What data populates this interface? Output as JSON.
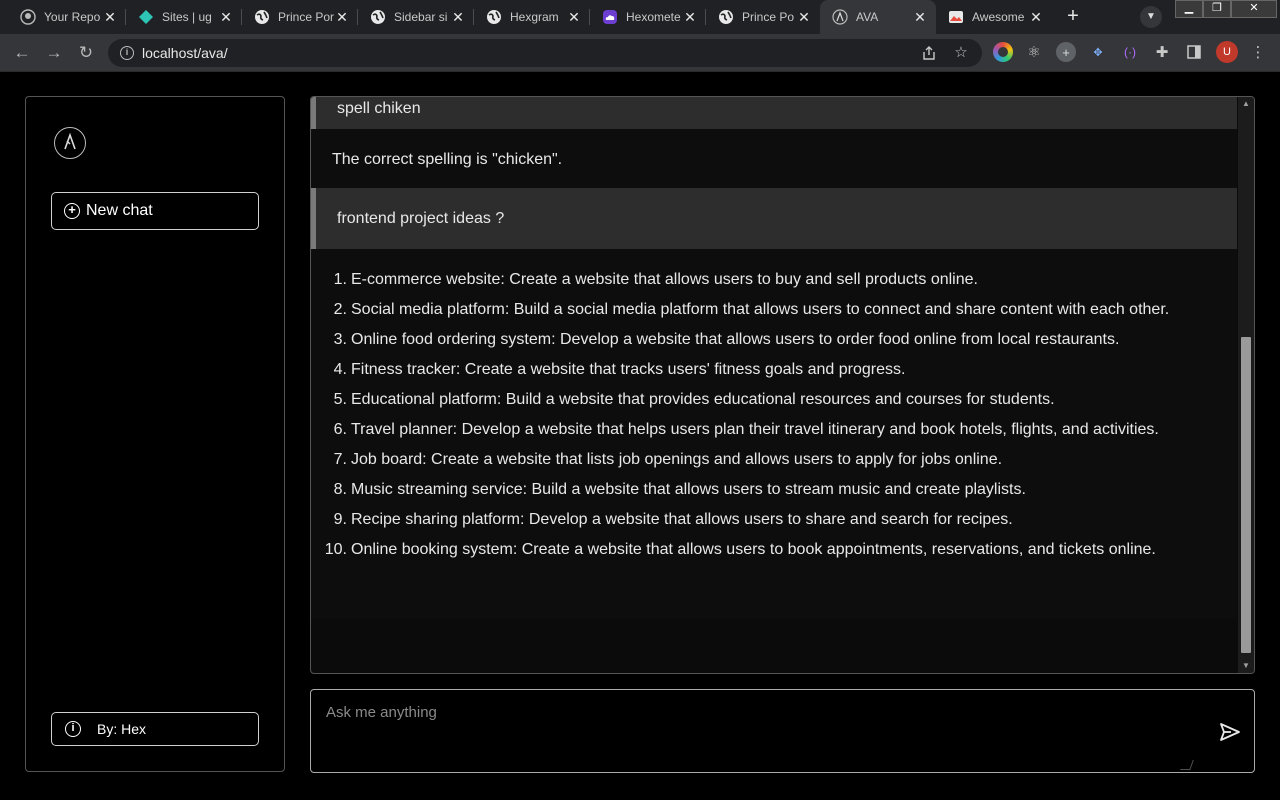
{
  "browser": {
    "tabs": [
      {
        "title": "Your Repo",
        "favicon": "github-icon"
      },
      {
        "title": "Sites | ug",
        "favicon": "diamond-icon"
      },
      {
        "title": "Prince Por",
        "favicon": "globe-icon"
      },
      {
        "title": "Sidebar si",
        "favicon": "globe-icon"
      },
      {
        "title": "Hexgram",
        "favicon": "globe-icon"
      },
      {
        "title": "Hexomete",
        "favicon": "cloud-icon"
      },
      {
        "title": "Prince Po",
        "favicon": "globe-icon"
      },
      {
        "title": "AVA",
        "favicon": "ava-logo-icon",
        "active": true
      },
      {
        "title": "Awesome",
        "favicon": "image-icon"
      }
    ],
    "url": "localhost/ava/",
    "avatar_letter": "U"
  },
  "sidebar": {
    "new_chat_label": "New chat",
    "credit_label": "By: Hex"
  },
  "chat": {
    "messages": [
      {
        "role": "user",
        "text": "spell chiken"
      },
      {
        "role": "assistant",
        "text": "The correct spelling is \"chicken\"."
      },
      {
        "role": "user",
        "text": "frontend project ideas ?"
      },
      {
        "role": "assistant",
        "list": [
          {
            "n": "1.",
            "text": "E-commerce website: Create a website that allows users to buy and sell products online."
          },
          {
            "n": "2.",
            "text": "Social media platform: Build a social media platform that allows users to connect and share content with each other."
          },
          {
            "n": "3.",
            "text": "Online food ordering system: Develop a website that allows users to order food online from local restaurants."
          },
          {
            "n": "4.",
            "text": "Fitness tracker: Create a website that tracks users' fitness goals and progress."
          },
          {
            "n": "5.",
            "text": "Educational platform: Build a website that provides educational resources and courses for students."
          },
          {
            "n": "6.",
            "text": "Travel planner: Develop a website that helps users plan their travel itinerary and book hotels, flights, and activities."
          },
          {
            "n": "7.",
            "text": "Job board: Create a website that lists job openings and allows users to apply for jobs online."
          },
          {
            "n": "8.",
            "text": "Music streaming service: Build a website that allows users to stream music and create playlists."
          },
          {
            "n": "9.",
            "text": "Recipe sharing platform: Develop a website that allows users to share and search for recipes."
          },
          {
            "n": "10.",
            "text": "Online booking system: Create a website that allows users to book appointments, reservations, and tickets online."
          }
        ]
      }
    ]
  },
  "composer": {
    "placeholder": "Ask me anything"
  },
  "colors": {
    "background": "#000000",
    "user_bubble": "#2d2d2d",
    "accent_border": "#7a7a7a",
    "avatar": "#c0392b"
  }
}
